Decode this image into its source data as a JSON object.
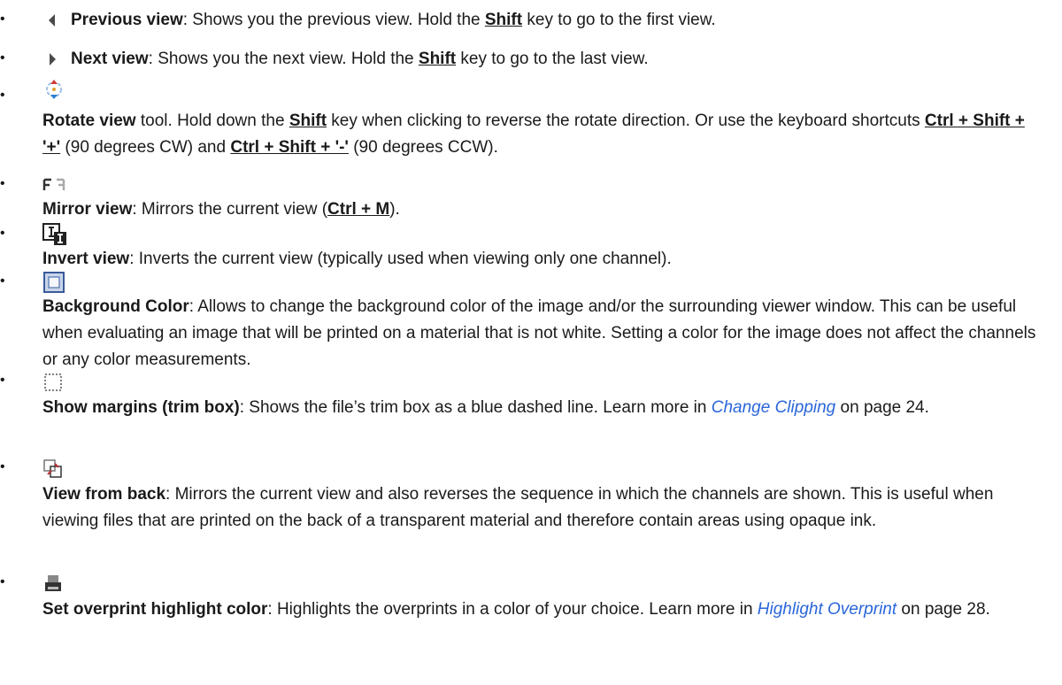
{
  "items": [
    {
      "icon": "triangle-left-icon",
      "label": "Previous view",
      "text": ": Shows you the previous view. Hold the ",
      "key": "Shift",
      "text2": " key to go to the first view."
    },
    {
      "icon": "triangle-right-icon",
      "label": "Next view",
      "text": ": Shows you the next view. Hold the ",
      "key": "Shift",
      "text2": " key to go to the last view."
    },
    {
      "icon": "rotate-icon",
      "label": "Rotate view",
      "text": " tool. Hold down the ",
      "key": "Shift",
      "text2": " key when clicking to reverse the rotate direction. Or use the keyboard shortcuts ",
      "key2": "Ctrl + Shift + '+'",
      "text3": " (90 degrees CW) and ",
      "key3": "Ctrl + Shift + '-'",
      "text4": " (90 degrees CCW)."
    },
    {
      "icon": "mirror-icon",
      "label": "Mirror view",
      "text": ": Mirrors the current view (",
      "key": "Ctrl + M",
      "text2": ")."
    },
    {
      "icon": "invert-icon",
      "label": "Invert view",
      "text": ": Inverts the current view (typically used when viewing only one channel)."
    },
    {
      "icon": "background-color-icon",
      "label": "Background Color",
      "text": ": Allows to change the background color of the image and/or the surrounding viewer window. This can be useful when evaluating an image that will be printed on a material that is not white. Setting a color for the image does not affect the channels or any color measurements."
    },
    {
      "icon": "margins-icon",
      "label": "Show margins (trim box)",
      "text": ": Shows the file’s trim box as a blue dashed line. Learn more in ",
      "link": "Change Clipping",
      "text2": " on page 24."
    },
    {
      "icon": "view-from-back-icon",
      "label": "View from back",
      "text": ": Mirrors the current view and also reverses the sequence in which the channels are shown. This is useful when viewing files that are printed on the back of a transparent material and therefore contain areas using opaque ink."
    },
    {
      "icon": "overprint-icon",
      "label": "Set overprint highlight color",
      "text": ": Highlights the overprints in a color of your choice. Learn more in ",
      "link": "Highlight Overprint",
      "text2": "  on page 28."
    }
  ],
  "colors": {
    "link": "#2a66d9",
    "text": "#1a1a1a"
  }
}
